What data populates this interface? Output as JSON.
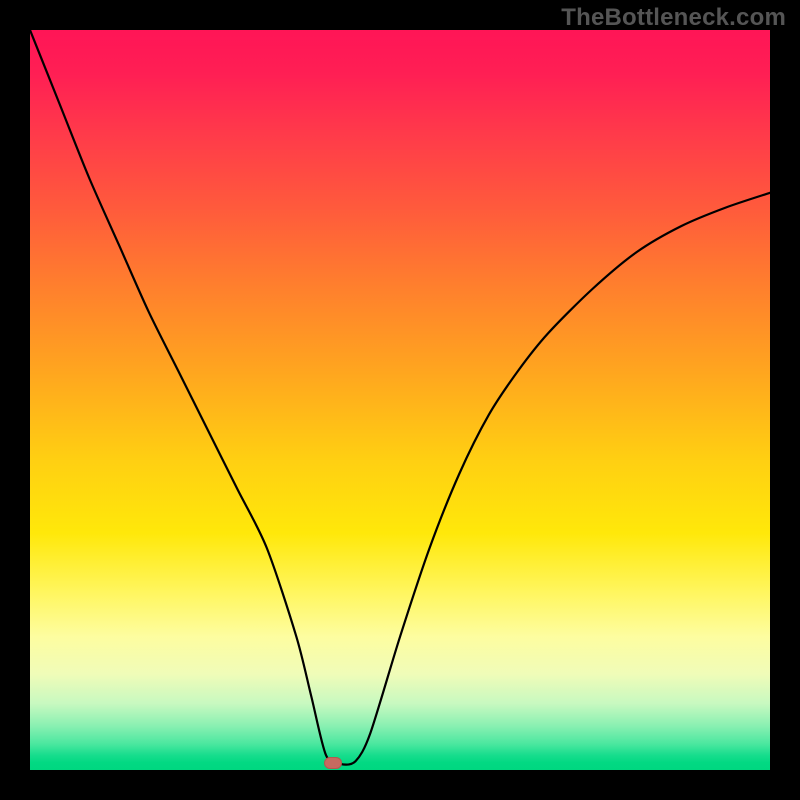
{
  "watermark": "TheBottleneck.com",
  "colors": {
    "background": "#000000",
    "gradient_top": "#ff1556",
    "gradient_mid": "#ffcf12",
    "gradient_bottom": "#00d780",
    "curve": "#000000",
    "marker": "#c76a60"
  },
  "chart_data": {
    "type": "line",
    "title": "",
    "xlabel": "",
    "ylabel": "",
    "xlim": [
      0,
      100
    ],
    "ylim": [
      0,
      100
    ],
    "grid": false,
    "annotations": [
      {
        "name": "minimum-marker",
        "x": 41,
        "y": 1
      }
    ],
    "series": [
      {
        "name": "bottleneck-curve",
        "x": [
          0,
          4,
          8,
          12,
          16,
          20,
          24,
          28,
          32,
          36,
          38,
          40,
          42,
          44,
          46,
          50,
          54,
          58,
          62,
          66,
          70,
          76,
          82,
          88,
          94,
          100
        ],
        "y": [
          100,
          90,
          80,
          71,
          62,
          54,
          46,
          38,
          30,
          18,
          10,
          2,
          0.8,
          1.2,
          5,
          18,
          30,
          40,
          48,
          54,
          59,
          65,
          70,
          73.5,
          76,
          78
        ]
      }
    ]
  }
}
